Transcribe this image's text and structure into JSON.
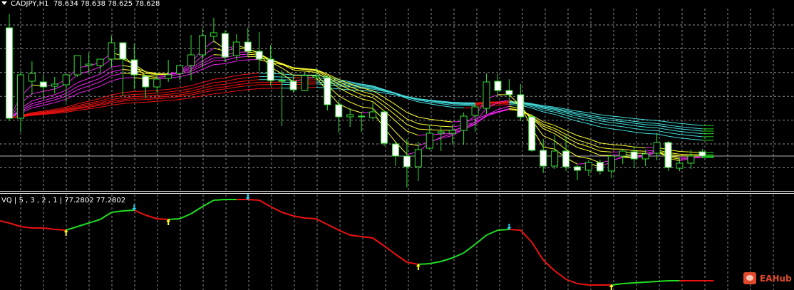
{
  "header": {
    "symbol": "CADJPY,H1",
    "ohlc": "78.634 78.638 78.625 78.628"
  },
  "indicator": {
    "label": "VQ | 5 , 3 , 2 , 1 |",
    "values": "77.2802 77.2802"
  },
  "logo": {
    "text": "EAHub"
  },
  "colors": {
    "bg": "#000000",
    "candle_outline": "#33dd33",
    "bull_body": "#000000",
    "bear_body": "#ffffff",
    "grid": "#8c8c8c",
    "price_line": "#b4b4b4",
    "fast_down": "#ffff33",
    "fast_up": "#ee22ee",
    "slow_down": "#44dddd",
    "slow_up": "#ee1111",
    "vq_up": "#22dd22",
    "vq_down": "#ee1111",
    "arrow_up": "#ffff22",
    "arrow_down": "#22ccee"
  },
  "chart_data": [
    {
      "type": "candlestick",
      "title": "CADJPY,H1",
      "ylim": [
        78.579,
        78.847
      ],
      "last_price": 78.628,
      "grid": true,
      "candles": [
        [
          78.808,
          78.827,
          78.677,
          78.681
        ],
        [
          78.681,
          78.747,
          78.662,
          78.742
        ],
        [
          78.733,
          78.761,
          78.714,
          78.744
        ],
        [
          78.732,
          78.742,
          78.707,
          78.725
        ],
        [
          78.726,
          78.739,
          78.716,
          78.729
        ],
        [
          78.728,
          78.742,
          78.704,
          78.742
        ],
        [
          78.742,
          78.769,
          78.739,
          78.769
        ],
        [
          78.755,
          78.772,
          78.745,
          78.757
        ],
        [
          78.755,
          78.764,
          78.744,
          78.764
        ],
        [
          78.764,
          78.796,
          78.752,
          78.787
        ],
        [
          78.787,
          78.787,
          78.712,
          78.764
        ],
        [
          78.763,
          78.785,
          78.722,
          78.742
        ],
        [
          78.74,
          78.742,
          78.709,
          78.725
        ],
        [
          78.725,
          78.744,
          78.717,
          78.736
        ],
        [
          78.737,
          78.763,
          78.732,
          78.742
        ],
        [
          78.744,
          78.755,
          78.734,
          78.755
        ],
        [
          78.755,
          78.798,
          78.734,
          78.77
        ],
        [
          78.77,
          78.807,
          78.752,
          78.797
        ],
        [
          78.796,
          78.822,
          78.787,
          78.801
        ],
        [
          78.8,
          78.804,
          78.76,
          78.767
        ],
        [
          78.769,
          78.799,
          78.763,
          78.788
        ],
        [
          78.788,
          78.808,
          78.767,
          78.775
        ],
        [
          78.775,
          78.802,
          78.747,
          78.764
        ],
        [
          78.764,
          78.784,
          78.727,
          78.734
        ],
        [
          78.733,
          78.749,
          78.67,
          78.734
        ],
        [
          78.733,
          78.742,
          78.717,
          78.721
        ],
        [
          78.72,
          78.745,
          78.719,
          78.741
        ],
        [
          78.738,
          78.752,
          78.734,
          78.74
        ],
        [
          78.738,
          78.742,
          78.692,
          78.7
        ],
        [
          78.7,
          78.707,
          78.661,
          78.683
        ],
        [
          78.683,
          78.695,
          78.669,
          78.686
        ],
        [
          78.683,
          78.69,
          78.662,
          78.684
        ],
        [
          78.682,
          78.703,
          78.68,
          78.69
        ],
        [
          78.69,
          78.692,
          78.642,
          78.646
        ],
        [
          78.645,
          78.647,
          78.614,
          78.628
        ],
        [
          78.628,
          78.652,
          78.584,
          78.613
        ],
        [
          78.613,
          78.648,
          78.593,
          78.637
        ],
        [
          78.639,
          78.672,
          78.637,
          78.66
        ],
        [
          78.66,
          78.669,
          78.635,
          78.662
        ],
        [
          78.66,
          78.672,
          78.644,
          78.664
        ],
        [
          78.664,
          78.689,
          78.644,
          78.684
        ],
        [
          78.685,
          78.702,
          78.662,
          78.697
        ],
        [
          78.695,
          78.744,
          78.687,
          78.732
        ],
        [
          78.733,
          78.743,
          78.712,
          78.72
        ],
        [
          78.72,
          78.736,
          78.707,
          78.714
        ],
        [
          78.714,
          78.729,
          78.677,
          78.683
        ],
        [
          78.683,
          78.687,
          78.634,
          78.636
        ],
        [
          78.636,
          78.652,
          78.604,
          78.614
        ],
        [
          78.614,
          78.657,
          78.61,
          78.635
        ],
        [
          78.635,
          78.657,
          78.607,
          78.613
        ],
        [
          78.613,
          78.615,
          78.594,
          78.608
        ],
        [
          78.608,
          78.622,
          78.6,
          78.619
        ],
        [
          78.619,
          78.623,
          78.602,
          78.607
        ],
        [
          78.607,
          78.629,
          78.597,
          78.628
        ],
        [
          78.628,
          78.637,
          78.617,
          78.635
        ],
        [
          78.634,
          78.642,
          78.612,
          78.624
        ],
        [
          78.624,
          78.637,
          78.614,
          78.631
        ],
        [
          78.632,
          78.66,
          78.622,
          78.647
        ],
        [
          78.647,
          78.649,
          78.607,
          78.612
        ],
        [
          78.611,
          78.625,
          78.607,
          78.618
        ],
        [
          78.618,
          78.637,
          78.61,
          78.628
        ],
        [
          78.634,
          78.638,
          78.625,
          78.628
        ]
      ]
    },
    {
      "type": "line",
      "title": "VQ | 5 , 3 , 2 , 1 |",
      "ylim": [
        77.2542,
        77.5242
      ],
      "values": [
        77.4422,
        77.4322,
        77.4282,
        77.4282,
        77.4242,
        77.4222,
        77.4322,
        77.4422,
        77.4522,
        77.4722,
        77.4762,
        77.4782,
        77.4642,
        77.4542,
        77.4522,
        77.4542,
        77.4682,
        77.4882,
        77.5062,
        77.5082,
        77.5082,
        77.5082,
        77.5062,
        77.4882,
        77.4722,
        77.4622,
        77.4562,
        77.4542,
        77.4382,
        77.4222,
        77.4082,
        77.4042,
        77.4002,
        77.3782,
        77.3542,
        77.3322,
        77.3262,
        77.3282,
        77.3342,
        77.3442,
        77.3582,
        77.3822,
        77.4082,
        77.4222,
        77.4242,
        77.4222,
        77.3882,
        77.3382,
        77.3082,
        77.2842,
        77.2722,
        77.2682,
        77.2682,
        77.2682,
        77.2722,
        77.2742,
        77.2762,
        77.2782,
        77.2802,
        77.2802,
        77.2802,
        77.2802
      ]
    }
  ]
}
